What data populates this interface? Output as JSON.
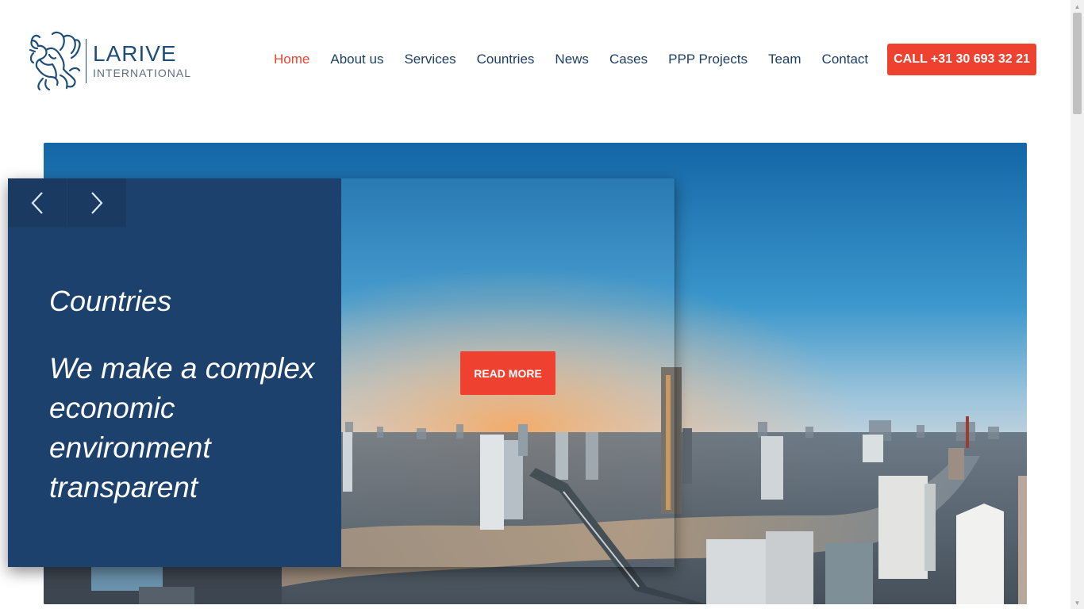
{
  "brand": {
    "name": "LARIVE",
    "subtitle": "INTERNATIONAL",
    "color": "#1f4d7a"
  },
  "nav": {
    "items": [
      {
        "label": "Home",
        "active": true
      },
      {
        "label": "About us"
      },
      {
        "label": "Services"
      },
      {
        "label": "Countries"
      },
      {
        "label": "News"
      },
      {
        "label": "Cases"
      },
      {
        "label": "PPP Projects"
      },
      {
        "label": "Team"
      },
      {
        "label": "Contact"
      }
    ],
    "call_label": "CALL +31 30 693 32 21",
    "accent": "#ef4130"
  },
  "hero": {
    "title": "Countries",
    "text": "We make a complex economic environment transparent",
    "cta_label": "READ MORE",
    "panel_color": "#1d416d",
    "prev_icon": "chevron-left-icon",
    "next_icon": "chevron-right-icon"
  }
}
